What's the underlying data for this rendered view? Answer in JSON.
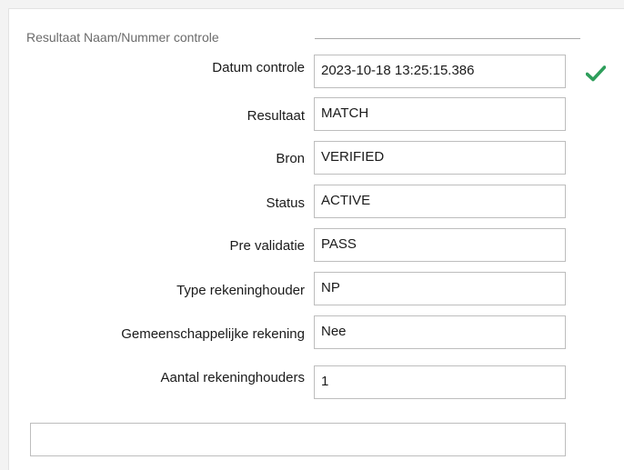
{
  "group": {
    "title": "Resultaat Naam/Nummer controle"
  },
  "rows": [
    {
      "label": "Datum controle",
      "value": "2023-10-18 13:25:15.386"
    },
    {
      "label": "Resultaat",
      "value": "MATCH"
    },
    {
      "label": "Bron",
      "value": "VERIFIED"
    },
    {
      "label": "Status",
      "value": "ACTIVE"
    },
    {
      "label": "Pre validatie",
      "value": "PASS"
    },
    {
      "label": "Type rekeninghouder",
      "value": "NP"
    },
    {
      "label": "Gemeenschappelijke rekening",
      "value": "Nee"
    },
    {
      "label": "Aantal rekeninghouders",
      "value": "1"
    }
  ],
  "check_icon": {
    "name": "checkmark-icon",
    "color": "#2e9e5b"
  },
  "bottom_field": {
    "value": ""
  }
}
